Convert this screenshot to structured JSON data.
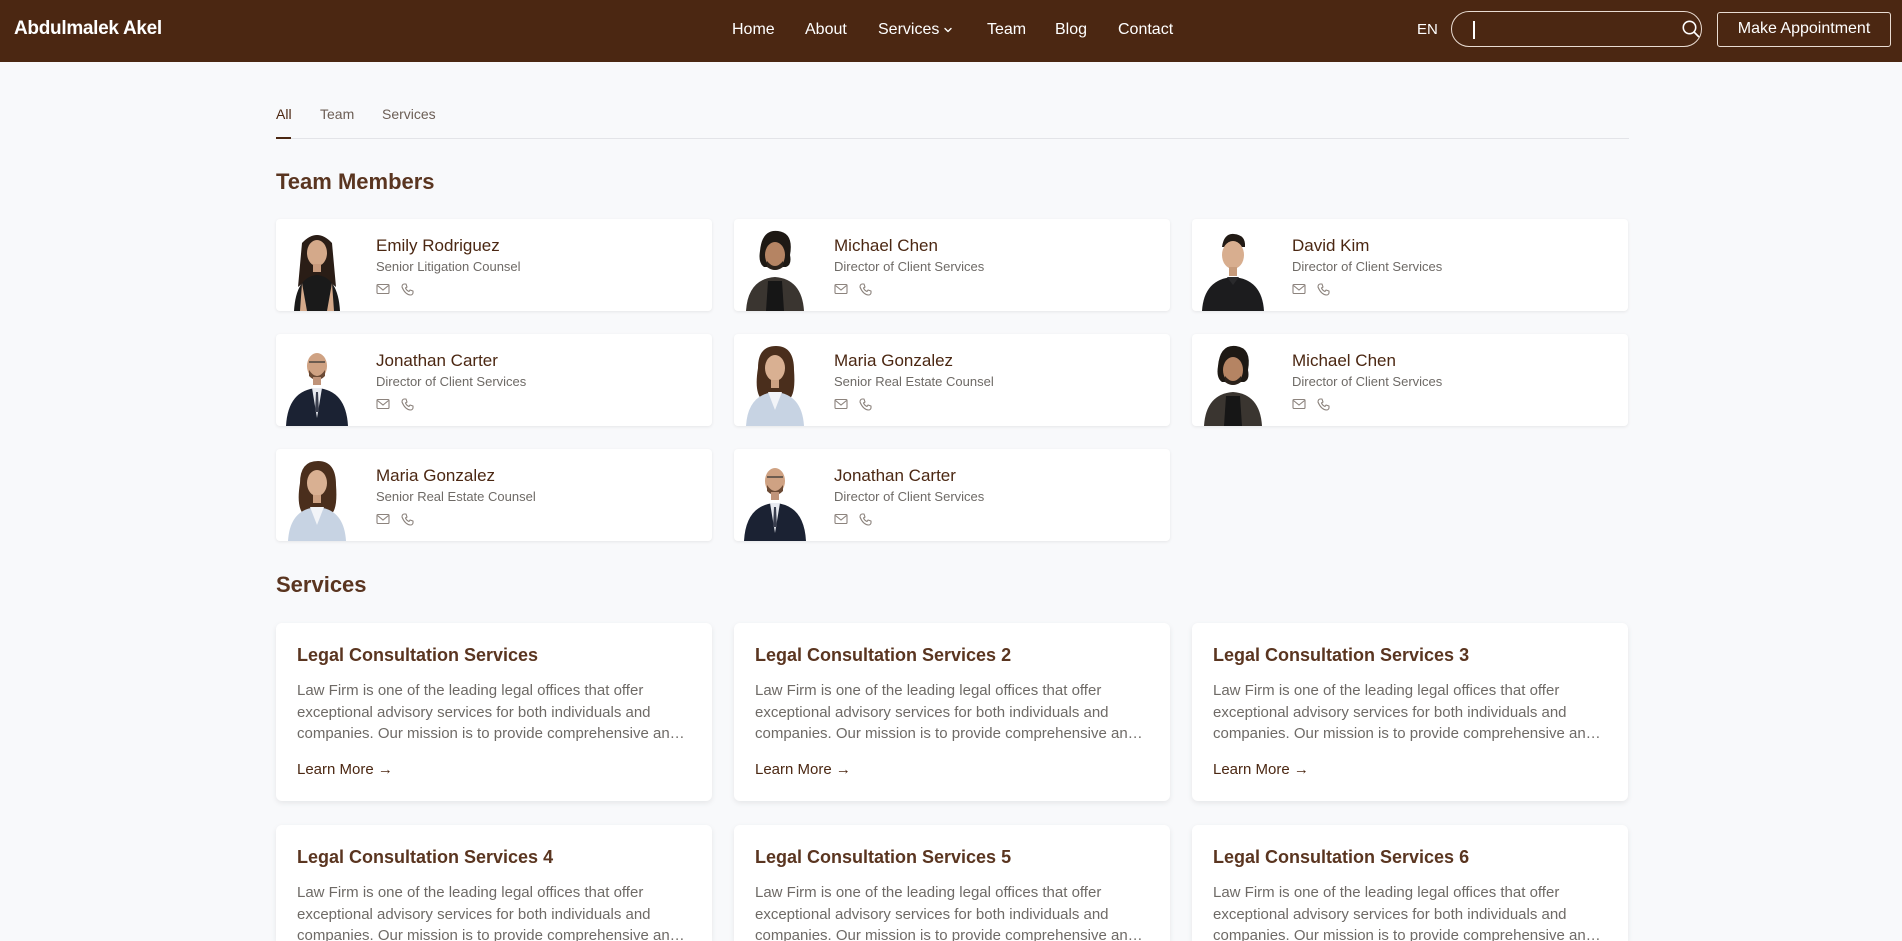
{
  "header": {
    "brand": "Abdulmalek Akel",
    "nav": [
      {
        "label": "Home"
      },
      {
        "label": "About"
      },
      {
        "label": "Services",
        "has_dropdown": true
      },
      {
        "label": "Team"
      },
      {
        "label": "Blog"
      },
      {
        "label": "Contact"
      }
    ],
    "language": "EN",
    "search": {
      "value": "",
      "placeholder": ""
    },
    "cta_label": "Make Appointment"
  },
  "tabs": [
    {
      "label": "All",
      "active": true
    },
    {
      "label": "Team",
      "active": false
    },
    {
      "label": "Services",
      "active": false
    }
  ],
  "team": {
    "title": "Team Members",
    "members": [
      {
        "name": "Emily Rodriguez",
        "role": "Senior Litigation Counsel",
        "photo": "woman-dark-hair-black-top"
      },
      {
        "name": "Michael Chen",
        "role": "Director of Client Services",
        "photo": "man-curly-hair-dark-cardigan"
      },
      {
        "name": "David Kim",
        "role": "Director of Client Services",
        "photo": "man-short-hair-black-shirt"
      },
      {
        "name": "Jonathan Carter",
        "role": "Director of Client Services",
        "photo": "man-beard-suit"
      },
      {
        "name": "Maria Gonzalez",
        "role": "Senior Real Estate Counsel",
        "photo": "woman-curly-hair-light-blazer"
      },
      {
        "name": "Michael Chen",
        "role": "Director of Client Services",
        "photo": "man-curly-hair-dark-cardigan"
      },
      {
        "name": "Maria Gonzalez",
        "role": "Senior Real Estate Counsel",
        "photo": "woman-curly-hair-light-blazer"
      },
      {
        "name": "Jonathan Carter",
        "role": "Director of Client Services",
        "photo": "man-beard-suit"
      }
    ]
  },
  "services": {
    "title": "Services",
    "items": [
      {
        "title": "Legal Consultation Services",
        "description": "Law Firm is one of the leading legal offices that offer exceptional advisory services for both individuals and companies. Our mission is to provide comprehensive and professional legal support to every client.",
        "link": "Learn More →"
      },
      {
        "title": "Legal Consultation Services 2",
        "description": "Law Firm is one of the leading legal offices that offer exceptional advisory services for both individuals and companies. Our mission is to provide comprehensive and professional legal support to every client.",
        "link": "Learn More →"
      },
      {
        "title": "Legal Consultation Services 3",
        "description": "Law Firm is one of the leading legal offices that offer exceptional advisory services for both individuals and companies. Our mission is to provide comprehensive and professional legal support to every client.",
        "link": "Learn More →"
      },
      {
        "title": "Legal Consultation Services 4",
        "description": "Law Firm is one of the leading legal offices that offer exceptional advisory services for both individuals and companies. Our mission is to provide comprehensive and professional legal support to every client.",
        "link": "Learn More →"
      },
      {
        "title": "Legal Consultation Services 5",
        "description": "Law Firm is one of the leading legal offices that offer exceptional advisory services for both individuals and companies. Our mission is to provide comprehensive and professional legal support to every client.",
        "link": "Learn More →"
      },
      {
        "title": "Legal Consultation Services 6",
        "description": "Law Firm is one of the leading legal offices that offer exceptional advisory services for both individuals and companies. Our mission is to provide comprehensive and professional legal support to every client.",
        "link": "Learn More →"
      }
    ]
  },
  "colors": {
    "brand_brown": "#4b2712",
    "heading_brown": "#5a3520",
    "page_bg": "#f8f9fb",
    "muted_text": "#6e6a66"
  }
}
